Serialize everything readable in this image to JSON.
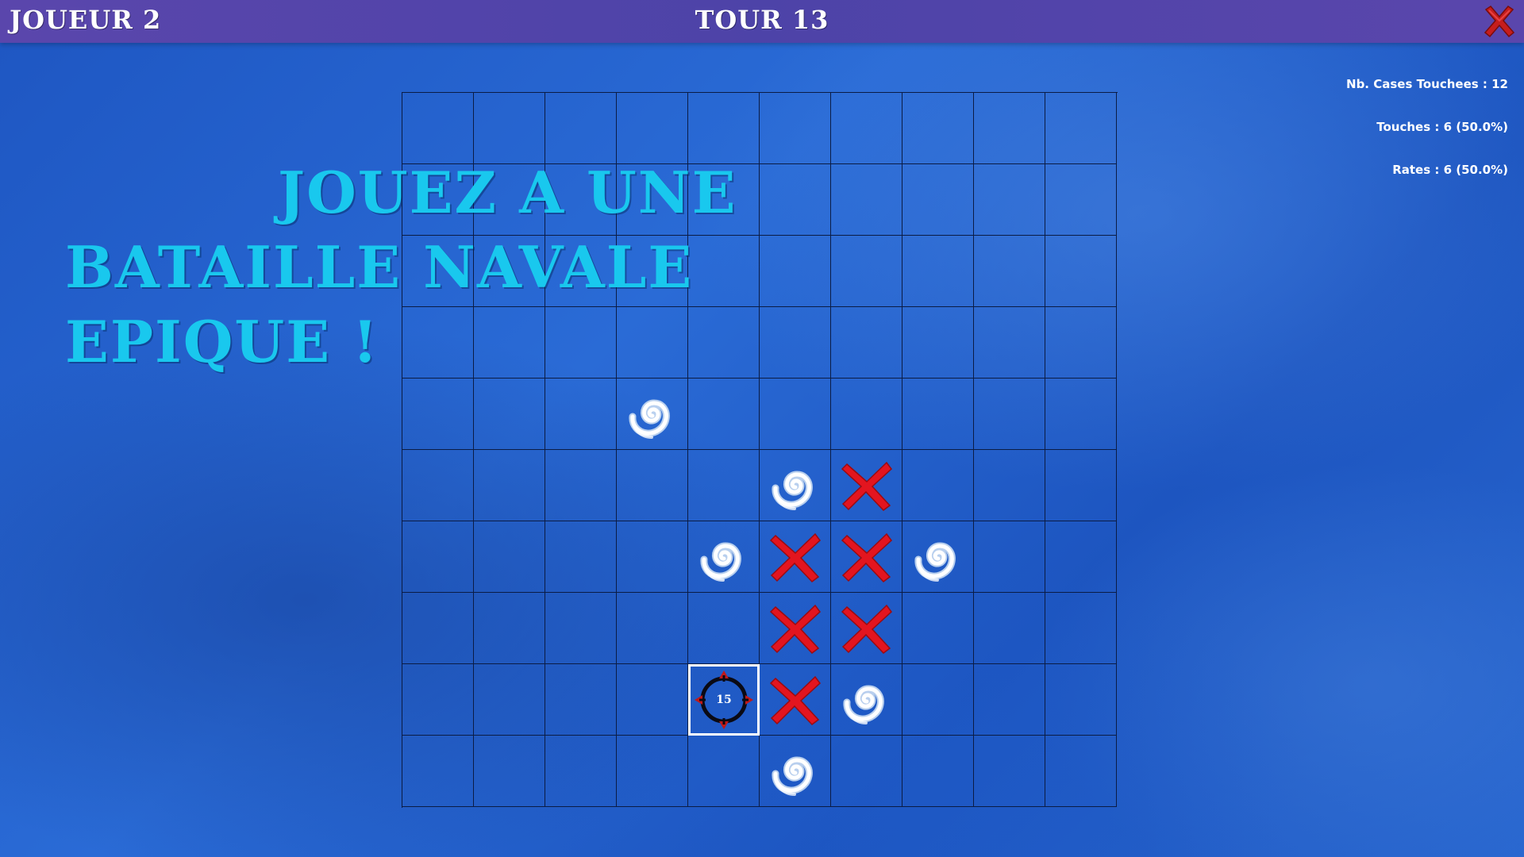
{
  "header": {
    "player": "JOUEUR 2",
    "turn": "TOUR 13",
    "close_icon": "close-x-icon",
    "close_color": "#d41f1f"
  },
  "stats": {
    "cells_hit": "Nb. Cases Touchees : 12",
    "hits": "Touches : 6 (50.0%)",
    "misses": "Rates : 6 (50.0%)"
  },
  "headline": {
    "line1": "JOUEZ A UNE",
    "line2": "BATAILLE NAVALE EPIQUE !",
    "color": "#19c8ee"
  },
  "board": {
    "size": 10,
    "hits": [
      [
        5,
        6
      ],
      [
        6,
        5
      ],
      [
        6,
        6
      ],
      [
        7,
        5
      ],
      [
        7,
        6
      ],
      [
        8,
        5
      ]
    ],
    "misses": [
      [
        4,
        3
      ],
      [
        5,
        5
      ],
      [
        6,
        4
      ],
      [
        6,
        7
      ],
      [
        8,
        6
      ],
      [
        9,
        5
      ]
    ],
    "cursor": {
      "row": 8,
      "col": 4,
      "label": "15"
    },
    "hit_icon": "red-x-icon",
    "miss_icon": "water-splash-swirl-icon",
    "cursor_icon": "crosshair-icon",
    "hit_color": "#e3151f",
    "miss_color": "#ffffff"
  }
}
